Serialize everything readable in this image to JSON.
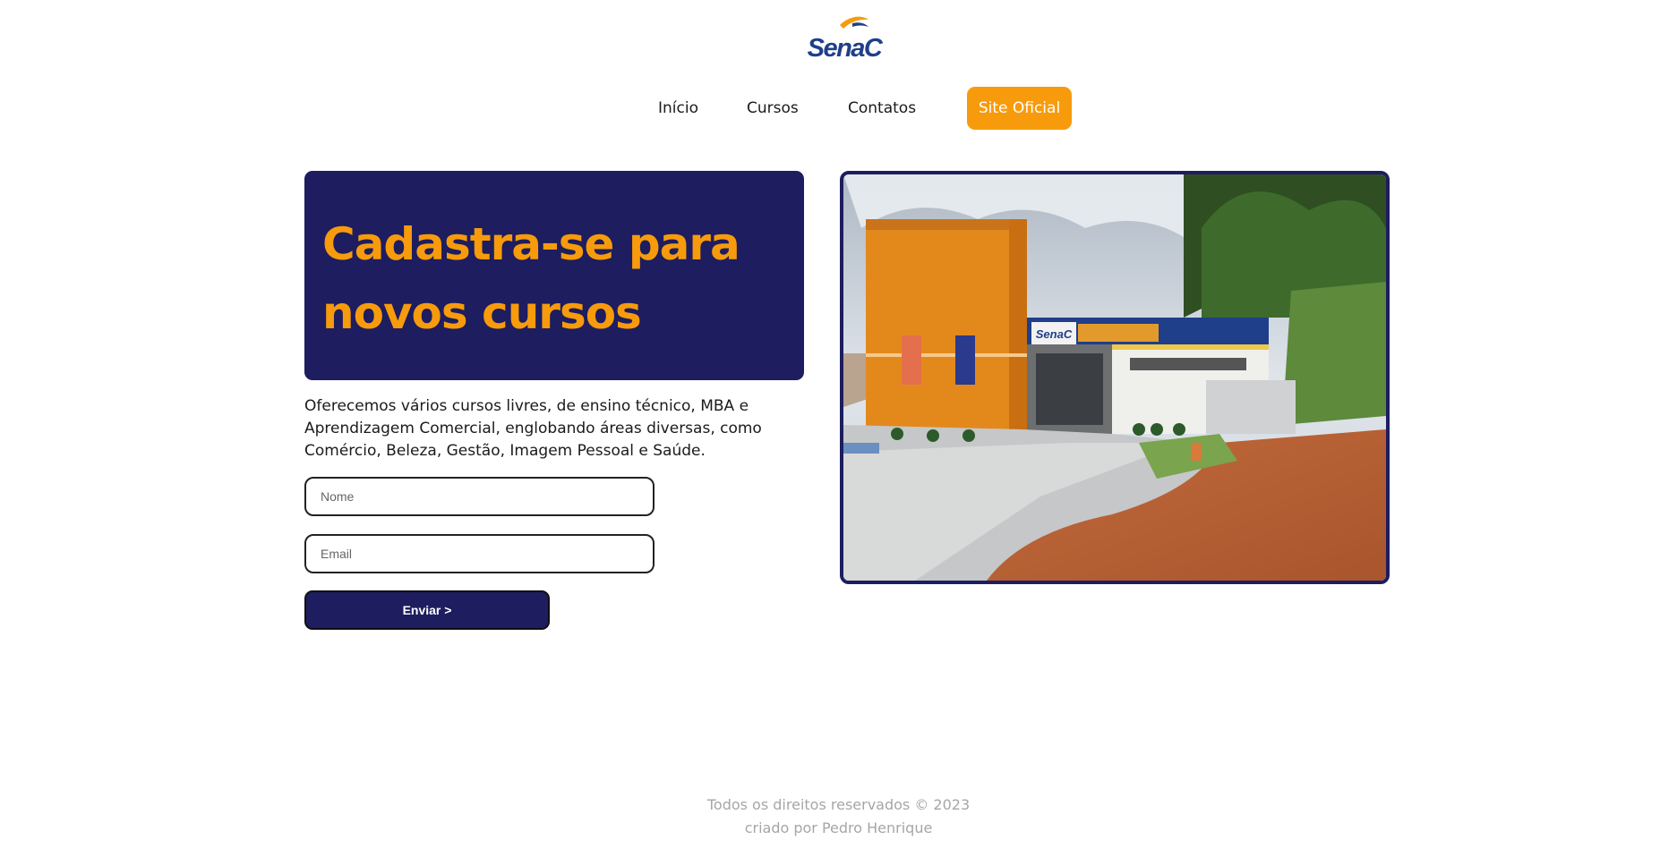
{
  "brand": {
    "logo_text": "SenaC",
    "logo_icon": "senac-logo"
  },
  "nav": {
    "items": [
      {
        "label": "Início"
      },
      {
        "label": "Cursos"
      },
      {
        "label": "Contatos"
      }
    ],
    "cta_label": "Site Oficial"
  },
  "hero": {
    "title_line1": "Cadastra-se para",
    "title_line2": "novos cursos",
    "intro_line1": "Oferecemos vários cursos livres, de ensino técnico, MBA e",
    "intro_line2": "Aprendizagem Comercial, englobando áreas diversas, como",
    "intro_line3": "Comércio, Beleza, Gestão, Imagem Pessoal e Saúde."
  },
  "form": {
    "name_placeholder": "Nome",
    "email_placeholder": "Email",
    "submit_label": "Enviar >"
  },
  "photo": {
    "sign_text": "SenaC"
  },
  "footer": {
    "line1": "Todos os direitos reservados © 2023",
    "line2": "criado por Pedro Henrique"
  },
  "colors": {
    "navy": "#1d1d5f",
    "orange": "#f79b0c",
    "text": "#1b1b1b",
    "muted": "#a6a6a6"
  }
}
